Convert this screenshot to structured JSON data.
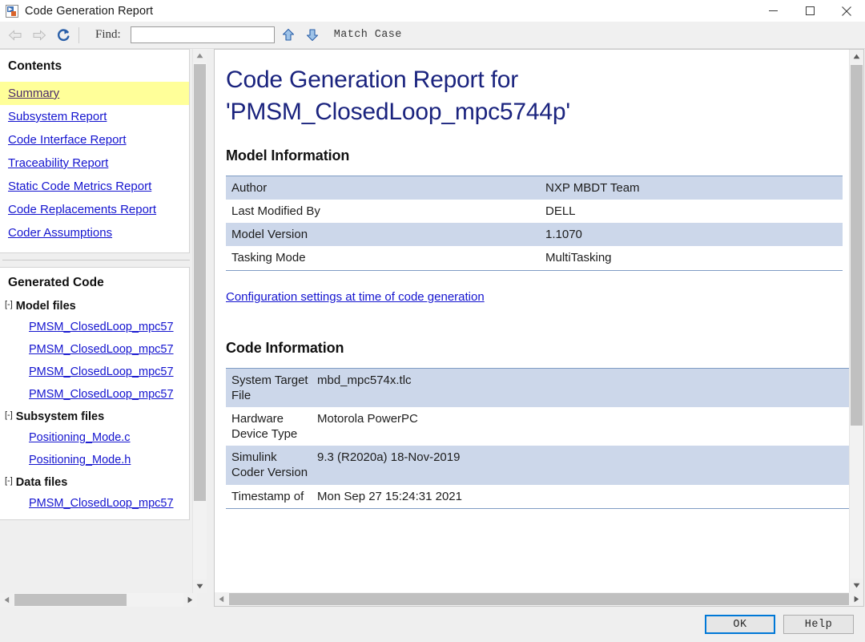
{
  "window": {
    "title": "Code Generation Report",
    "icon": "matlab-report-icon",
    "controls": {
      "minimize": "minimize-icon",
      "maximize": "maximize-icon",
      "close": "close-icon"
    }
  },
  "toolbar": {
    "back": "back-arrow-icon",
    "forward": "forward-arrow-icon",
    "refresh": "refresh-icon",
    "find_label": "Find:",
    "find_value": "",
    "find_placeholder": "",
    "find_prev": "find-previous-icon",
    "find_next": "find-next-icon",
    "match_case_label": "Match Case"
  },
  "sidebar": {
    "contents_heading": "Contents",
    "contents_items": [
      {
        "label": "Summary",
        "highlighted": true
      },
      {
        "label": "Subsystem Report",
        "highlighted": false
      },
      {
        "label": "Code Interface Report",
        "highlighted": false
      },
      {
        "label": "Traceability Report",
        "highlighted": false
      },
      {
        "label": "Static Code Metrics Report",
        "highlighted": false
      },
      {
        "label": "Code Replacements Report",
        "highlighted": false
      },
      {
        "label": "Coder Assumptions",
        "highlighted": false
      }
    ],
    "generated_code_heading": "Generated Code",
    "expander_glyph": "[-]",
    "groups": [
      {
        "label": "Model files",
        "files": [
          "PMSM_ClosedLoop_mpc57",
          "PMSM_ClosedLoop_mpc57",
          "PMSM_ClosedLoop_mpc57",
          "PMSM_ClosedLoop_mpc57"
        ]
      },
      {
        "label": "Subsystem files",
        "files": [
          "Positioning_Mode.c",
          "Positioning_Mode.h"
        ]
      },
      {
        "label": "Data files",
        "files": [
          "PMSM_ClosedLoop_mpc57"
        ]
      }
    ]
  },
  "document": {
    "title_line1": "Code Generation Report for",
    "title_line2": "'PMSM_ClosedLoop_mpc5744p'",
    "model_info_heading": "Model Information",
    "model_info_rows": [
      {
        "key": "Author",
        "value": "NXP MBDT Team"
      },
      {
        "key": "Last Modified By",
        "value": "DELL"
      },
      {
        "key": "Model Version",
        "value": "1.1070"
      },
      {
        "key": "Tasking Mode",
        "value": "MultiTasking"
      }
    ],
    "config_link": "Configuration settings at time of code generation",
    "code_info_heading": "Code Information",
    "code_info_rows": [
      {
        "key": "System Target File",
        "value": "mbd_mpc574x.tlc"
      },
      {
        "key": "Hardware Device Type",
        "value": "Motorola PowerPC"
      },
      {
        "key": "Simulink Coder Version",
        "value": "9.3 (R2020a) 18-Nov-2019"
      },
      {
        "key": "Timestamp of",
        "value": "Mon Sep 27 15:24:31 2021"
      }
    ]
  },
  "footer": {
    "ok_label": "OK",
    "help_label": "Help"
  },
  "scrollbars": {
    "sidebar_v_up": "scroll-up-icon",
    "sidebar_v_down": "scroll-down-icon",
    "sidebar_h_left": "scroll-left-icon",
    "sidebar_h_right": "scroll-right-icon",
    "doc_v_up": "scroll-up-icon",
    "doc_v_down": "scroll-down-icon",
    "doc_h_left": "scroll-left-icon",
    "doc_h_right": "scroll-right-icon"
  },
  "colors": {
    "link": "#1414cf",
    "highlight": "#ffff99",
    "heading": "#1a237e",
    "table_alt_row": "#ccd7ea",
    "focus_border": "#0078d7"
  }
}
